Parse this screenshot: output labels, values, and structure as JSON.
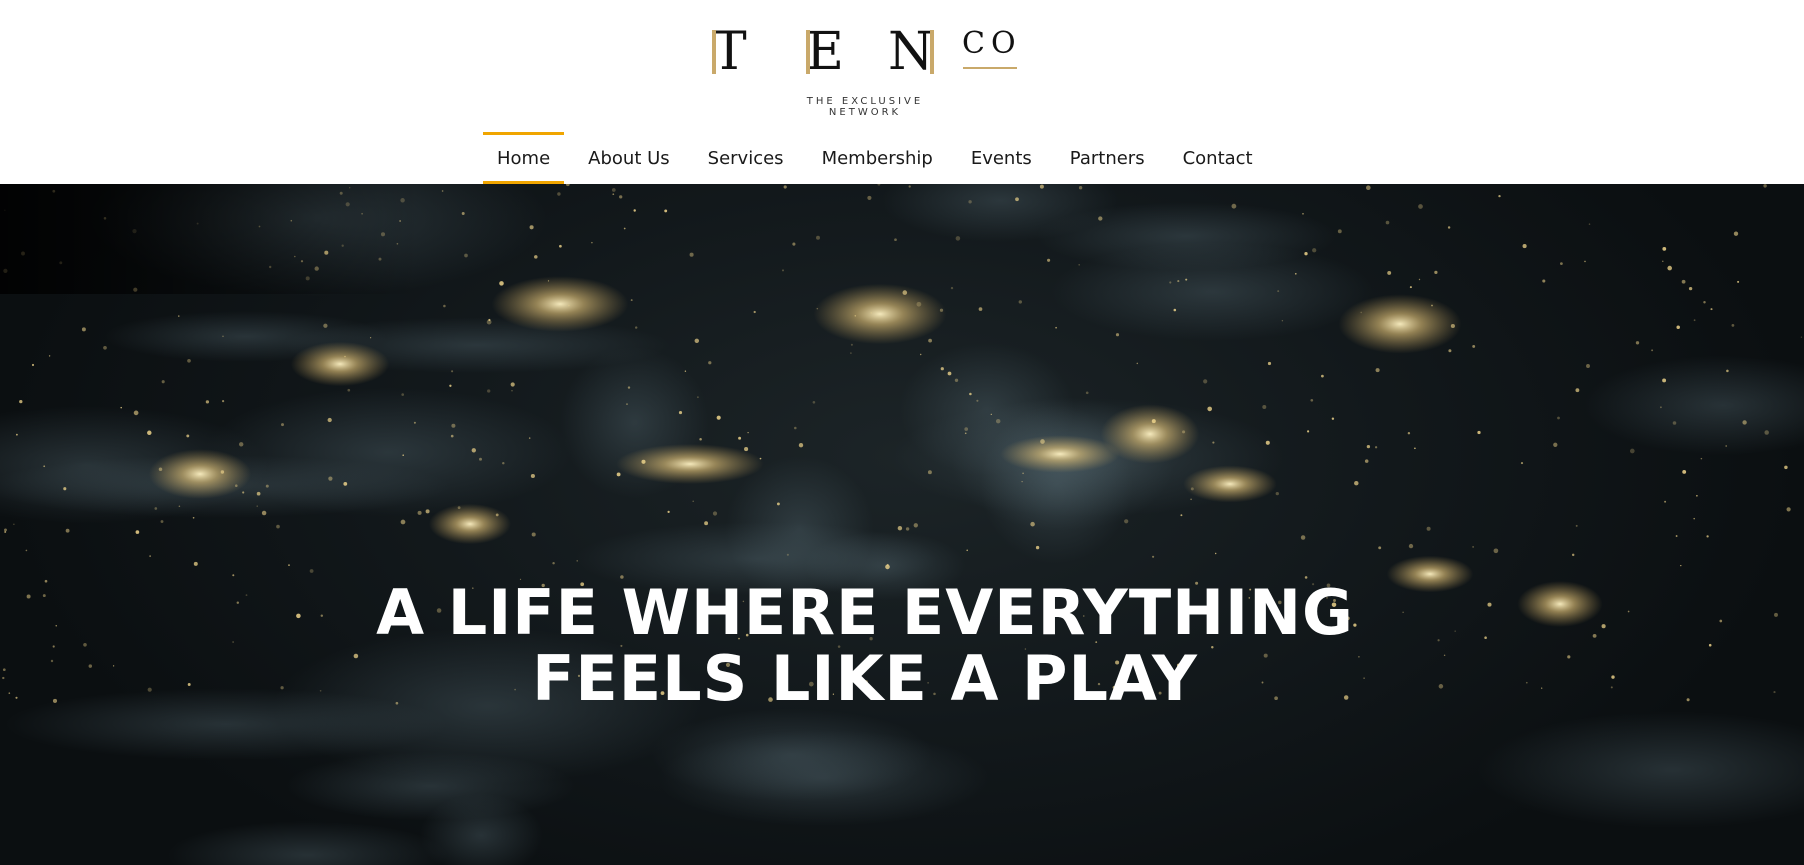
{
  "brand": {
    "letters": [
      "T",
      "E",
      "N"
    ],
    "suffix": "CO",
    "tagline": "THE EXCLUSIVE NETWORK",
    "accent_color": "#c9a96a"
  },
  "nav": {
    "active_color": "#f0a500",
    "items": [
      {
        "label": "Home",
        "active": true
      },
      {
        "label": "About Us",
        "active": false
      },
      {
        "label": "Services",
        "active": false
      },
      {
        "label": "Membership",
        "active": false
      },
      {
        "label": "Events",
        "active": false
      },
      {
        "label": "Partners",
        "active": false
      },
      {
        "label": "Contact",
        "active": false
      }
    ]
  },
  "hero": {
    "line1": "A LIFE WHERE EVERYTHING",
    "line2": "FEELS LIKE A PLAY",
    "background": "earth-at-night-city-lights"
  }
}
